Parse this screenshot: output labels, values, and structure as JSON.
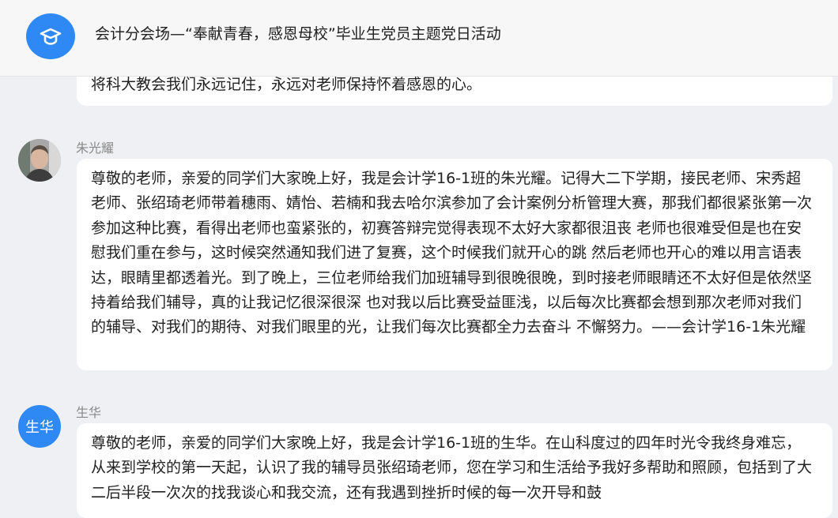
{
  "header": {
    "title": "会计分会场—“奉献青春，感恩母校”毕业生党员主题党日活动",
    "logo_icon": "graduation-cap-icon",
    "accent_color": "#2f89f5"
  },
  "messages": [
    {
      "text": "将科大教会我们永远记住，永远对老师保持怀着感恩的心。"
    },
    {
      "sender": "朱光耀",
      "avatar_type": "photo",
      "text": "尊敬的老师，亲爱的同学们大家晚上好，我是会计学16-1班的朱光耀。记得大二下学期，接民老师、宋秀超老师、张绍琦老师带着穗雨、婧怡、若楠和我去哈尔滨参加了会计案例分析管理大赛，那我们都很紧张第一次参加这种比赛，看得出老师也蛮紧张的，初赛答辩完觉得表现不太好大家都很沮丧 老师也很难受但是也在安慰我们重在参与，这时候突然通知我们进了复赛，这个时候我们就开心的跳 然后老师也开心的难以用言语表达，眼睛里都透着光。到了晚上，三位老师给我们加班辅导到很晚很晚，到时接老师眼睛还不太好但是依然坚持着给我们辅导，真的让我记忆很深很深 也对我以后比赛受益匪浅，以后每次比赛都会想到那次老师对我们的辅导、对我们的期待、对我们眼里的光，让我们每次比赛都全力去奋斗 不懈努力。——会计学16-1朱光耀"
    },
    {
      "sender": "生华",
      "avatar_type": "text",
      "avatar_text": "生华",
      "text": "尊敬的老师，亲爱的同学们大家晚上好，我是会计学16-1班的生华。在山科度过的四年时光令我终身难忘，从来到学校的第一天起，认识了我的辅导员张绍琦老师，您在学习和生活给予我好多帮助和照顾，包括到了大二后半段一次次的找我谈心和我交流，还有我遇到挫折时候的每一次开导和鼓"
    }
  ]
}
